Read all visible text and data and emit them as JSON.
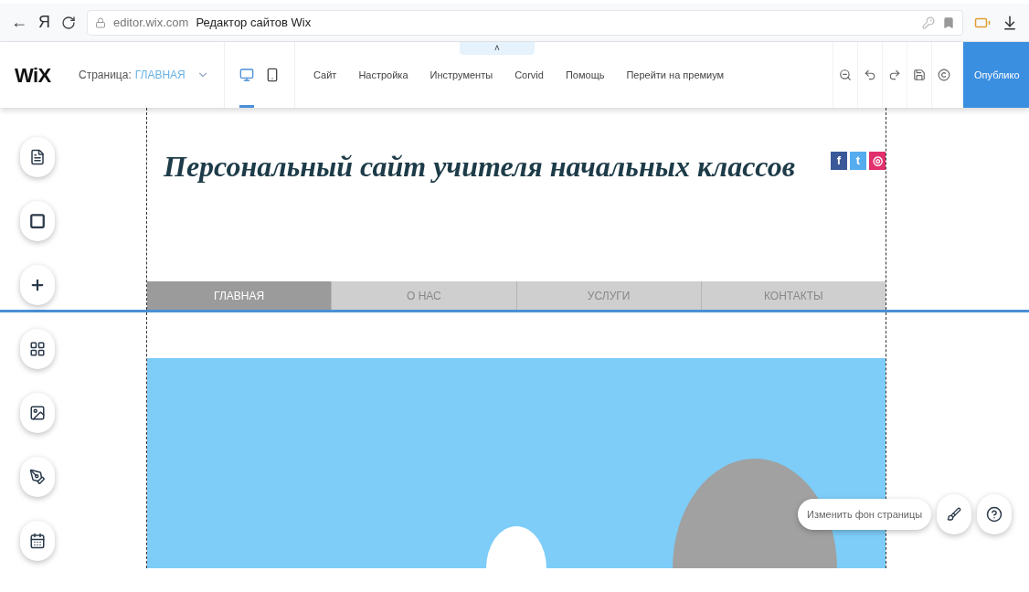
{
  "browser": {
    "domain": "editor.wix.com",
    "title": "Редактор сайтов Wix",
    "back": "←",
    "yandex": "Я"
  },
  "toolbar": {
    "logo": "WiX",
    "page_label": "Страница:",
    "page_value": "ГЛАВНАЯ",
    "devices": [
      {
        "kind": "desktop",
        "selected": true
      },
      {
        "kind": "mobile",
        "selected": false
      }
    ],
    "collapse": "˄",
    "menu": [
      "Сайт",
      "Настройка",
      "Инструменты",
      "Corvid",
      "Помощь",
      "Перейти на премиум"
    ],
    "publish": "Опублико"
  },
  "site": {
    "title": "Персональный сайт учителя начальных классов",
    "social": [
      {
        "label": "f",
        "color": "#3b5998"
      },
      {
        "label": "t",
        "color": "#55acee"
      },
      {
        "label": "◎",
        "color": "#e1306c"
      }
    ],
    "nav": [
      {
        "label": "ГЛАВНАЯ",
        "selected": true
      },
      {
        "label": "О НАС",
        "selected": false
      },
      {
        "label": "УСЛУГИ",
        "selected": false
      },
      {
        "label": "КОНТАКТЫ",
        "selected": false
      }
    ]
  },
  "page_background": {
    "label": "Изменить фон страницы"
  }
}
